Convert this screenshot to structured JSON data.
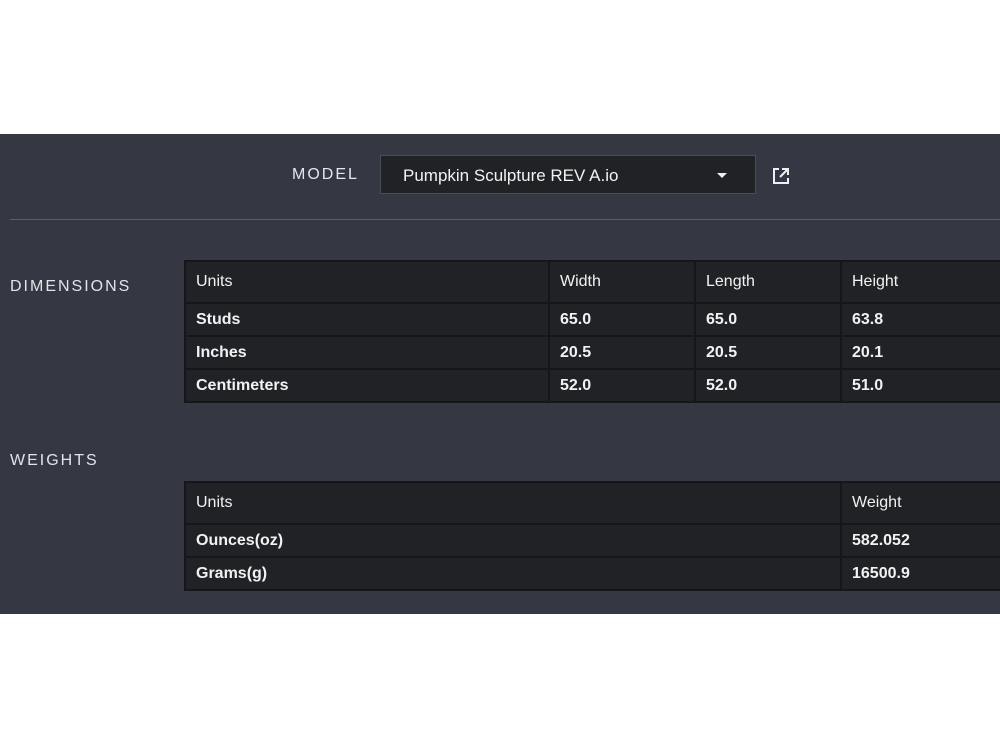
{
  "model": {
    "label": "MODEL",
    "selected": "Pumpkin Sculpture REV A.io"
  },
  "icons": {
    "dropdown": "chevron-down-icon",
    "open": "external-link-icon"
  },
  "dimensions": {
    "section_label": "DIMENSIONS",
    "headers": [
      "Units",
      "Width",
      "Length",
      "Height"
    ],
    "rows": [
      [
        "Studs",
        "65.0",
        "65.0",
        "63.8"
      ],
      [
        "Inches",
        "20.5",
        "20.5",
        "20.1"
      ],
      [
        "Centimeters",
        "52.0",
        "52.0",
        "51.0"
      ]
    ]
  },
  "weights": {
    "section_label": "WEIGHTS",
    "headers": [
      "Units",
      "Weight"
    ],
    "rows": [
      [
        "Ounces(oz)",
        "582.052"
      ],
      [
        "Grams(g)",
        "16500.9"
      ]
    ]
  },
  "colors": {
    "panel_bg": "#353842",
    "table_bg": "#202226",
    "text": "#f2f2f2"
  }
}
